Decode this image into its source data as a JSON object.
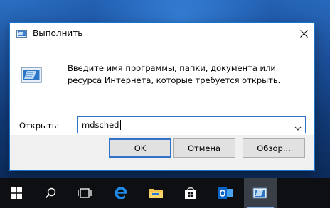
{
  "dialog": {
    "title": "Выполнить",
    "description": "Введите имя программы, папки, документа или ресурса Интернета, которые требуется открыть.",
    "open_label": "Открыть:",
    "open_value": "mdsched",
    "buttons": {
      "ok": "OK",
      "cancel": "Отмена",
      "browse": "Обзор..."
    }
  },
  "taskbar": {
    "items": [
      {
        "icon": "windows-start-icon"
      },
      {
        "icon": "search-icon"
      },
      {
        "icon": "task-view-icon"
      },
      {
        "icon": "edge-browser-icon"
      },
      {
        "icon": "file-explorer-icon"
      },
      {
        "icon": "store-icon"
      },
      {
        "icon": "outlook-icon"
      },
      {
        "icon": "run-dialog-icon",
        "active": true
      }
    ]
  },
  "colors": {
    "accent": "#2f73c9",
    "taskbar": "#0e0f13",
    "desktop": "#1c4e96"
  }
}
